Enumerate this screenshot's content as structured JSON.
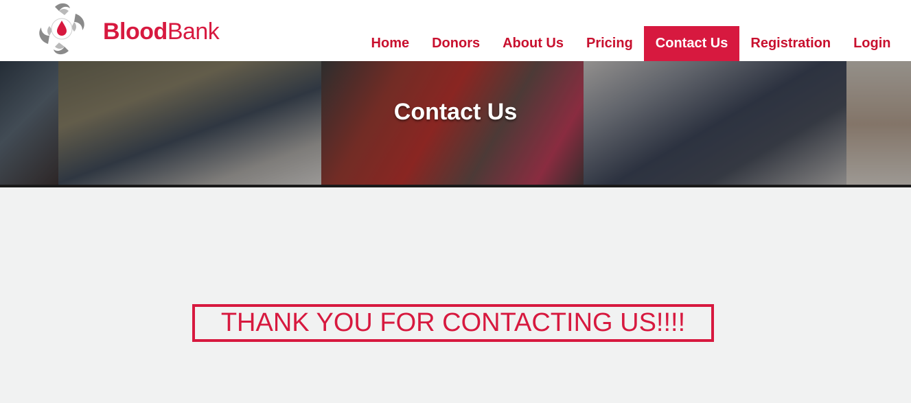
{
  "brand": {
    "name_bold": "Blood",
    "name_light": "Bank",
    "accent": "#d7193f"
  },
  "nav": {
    "items": [
      {
        "label": "Home"
      },
      {
        "label": "Donors"
      },
      {
        "label": "About Us"
      },
      {
        "label": "Pricing"
      },
      {
        "label": "Contact Us",
        "active": true
      },
      {
        "label": "Registration"
      },
      {
        "label": "Login"
      }
    ]
  },
  "banner": {
    "title": "Contact Us"
  },
  "main": {
    "message": "THANK YOU FOR CONTACTING US!!!!"
  },
  "icons": {
    "logo": "blood-drop-hands-logo"
  }
}
